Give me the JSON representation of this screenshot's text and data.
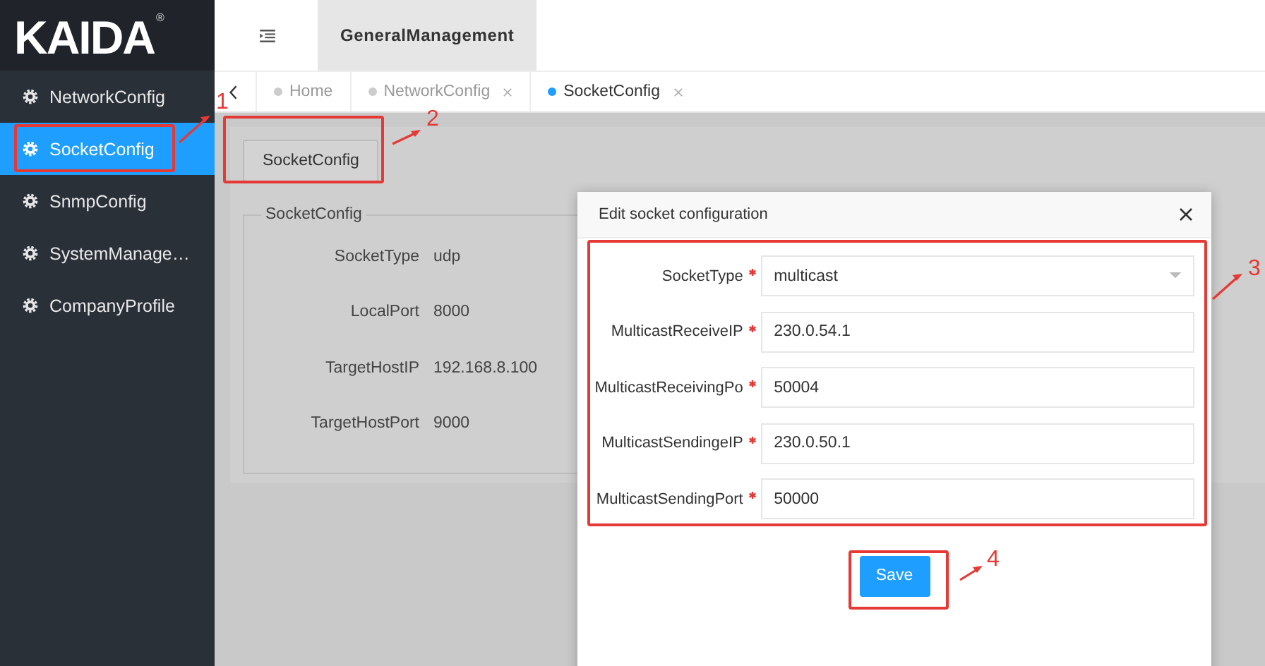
{
  "logo": {
    "text": "KAIDA",
    "mark": "®"
  },
  "sidebar": {
    "items": [
      {
        "label": "NetworkConfig",
        "selected": false
      },
      {
        "label": "SocketConfig",
        "selected": true
      },
      {
        "label": "SnmpConfig",
        "selected": false
      },
      {
        "label": "SystemManage…",
        "selected": false
      },
      {
        "label": "CompanyProfile",
        "selected": false
      }
    ]
  },
  "header": {
    "tab": "GeneralManagement"
  },
  "tabs": [
    {
      "label": "Home",
      "selected": false,
      "closable": false
    },
    {
      "label": "NetworkConfig",
      "selected": false,
      "closable": true
    },
    {
      "label": "SocketConfig",
      "selected": true,
      "closable": true
    }
  ],
  "content": {
    "button": "SocketConfig",
    "legend": "SocketConfig",
    "rows": [
      {
        "label": "SocketType",
        "value": "udp"
      },
      {
        "label": "LocalPort",
        "value": "8000"
      },
      {
        "label": "TargetHostIP",
        "value": "192.168.8.100"
      },
      {
        "label": "TargetHostPort",
        "value": "9000"
      }
    ]
  },
  "dialog": {
    "title": "Edit socket configuration",
    "fields": [
      {
        "kind": "select",
        "label": "SocketType",
        "required": true,
        "value": "multicast"
      },
      {
        "kind": "text",
        "label": "MulticastReceiveIP",
        "required": true,
        "value": "230.0.54.1"
      },
      {
        "kind": "text",
        "label": "MulticastReceivingPo",
        "required": true,
        "value": "50004"
      },
      {
        "kind": "text",
        "label": "MulticastSendingeIP",
        "required": true,
        "value": "230.0.50.1"
      },
      {
        "kind": "text",
        "label": "MulticastSendingPort",
        "required": true,
        "value": "50000"
      }
    ],
    "save_button": "Save"
  },
  "annotations": [
    {
      "number": "1"
    },
    {
      "number": "2"
    },
    {
      "number": "3"
    },
    {
      "number": "4"
    }
  ]
}
